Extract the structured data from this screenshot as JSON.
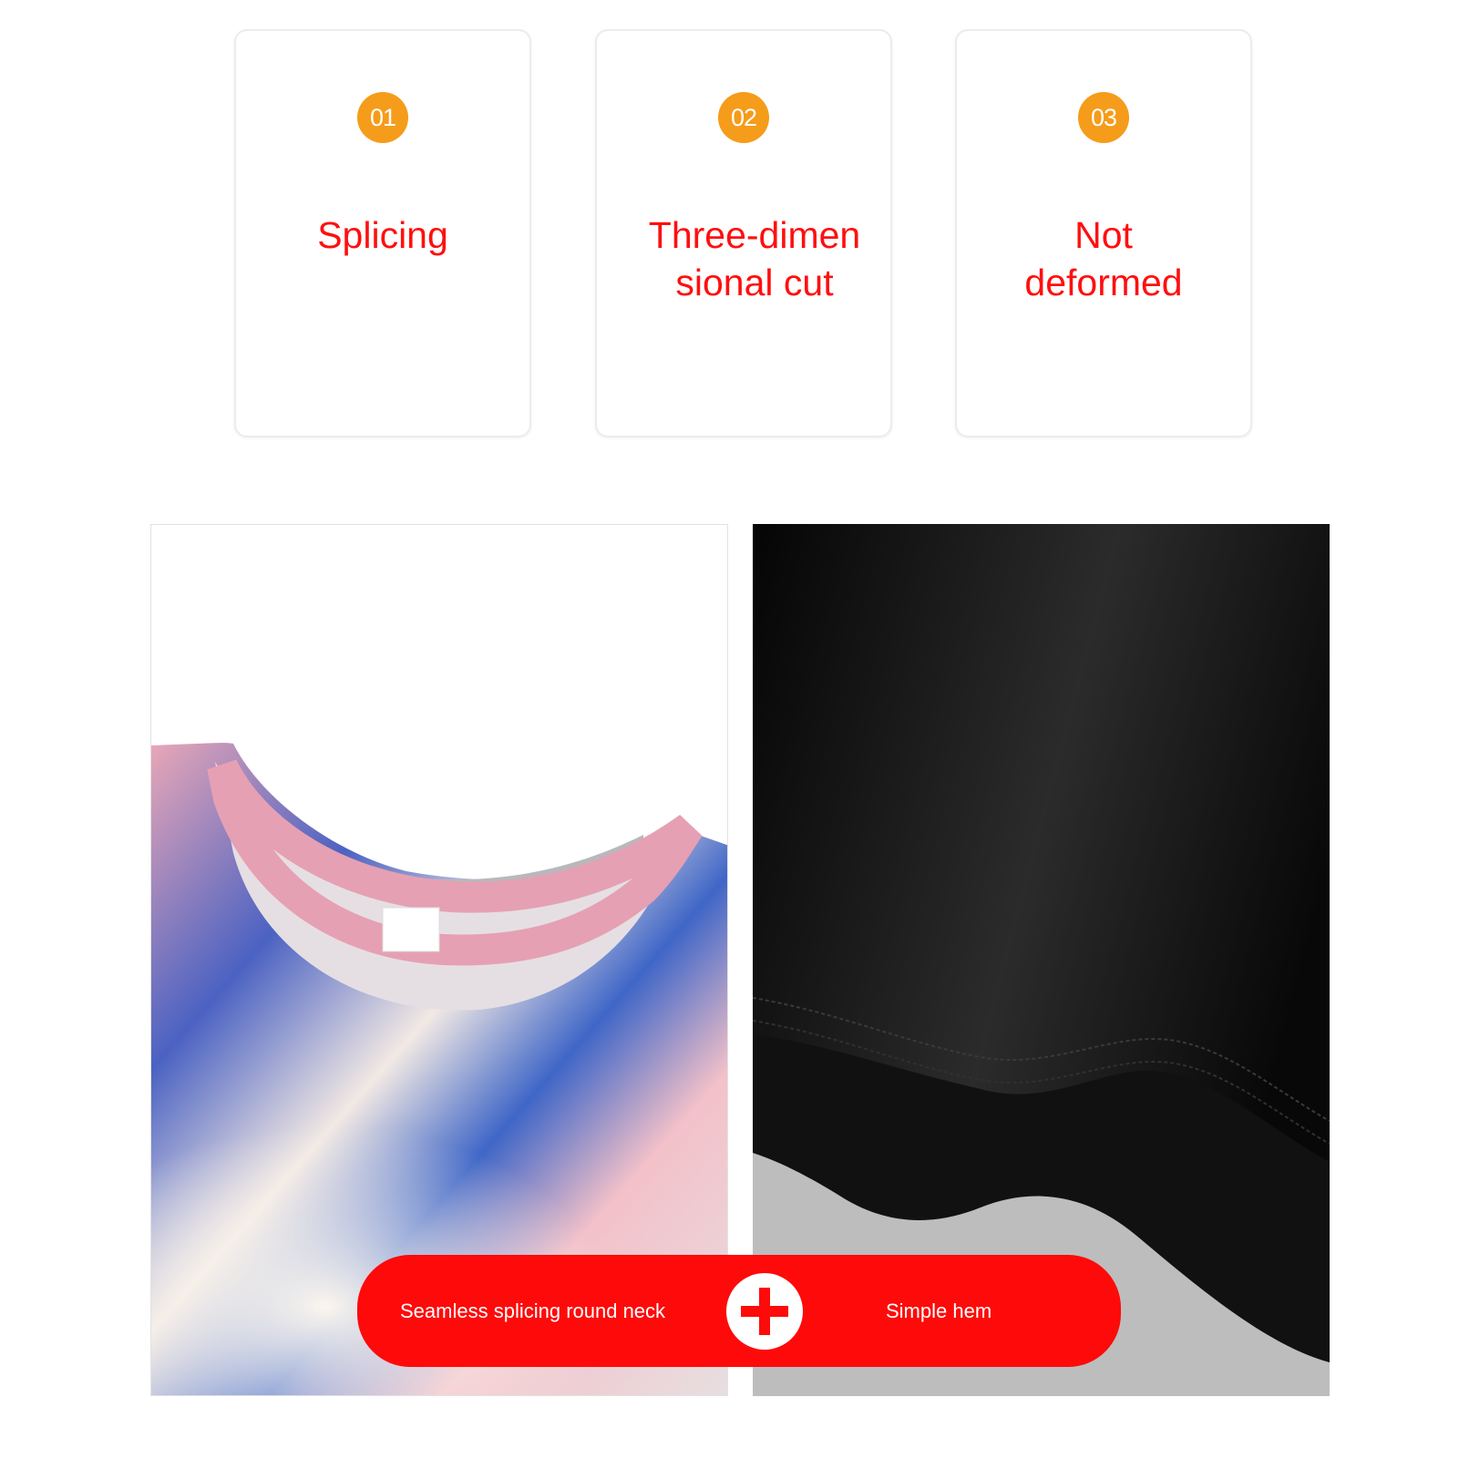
{
  "colors": {
    "badge": "#f59c1a",
    "title_text": "#ff0f0f",
    "pill": "#ff0a0a",
    "pill_text": "#ffffff"
  },
  "features": [
    {
      "number": "01",
      "title": "Splicing"
    },
    {
      "number": "02",
      "title": "Three-dimen sional cut"
    },
    {
      "number": "03",
      "title": "Not deformed"
    }
  ],
  "photos": {
    "left": {
      "subject": "galaxy-print round neck shirt photo"
    },
    "right": {
      "subject": "black shirt hem photo"
    }
  },
  "banner": {
    "left_label": "Seamless splicing round neck",
    "right_label": "Simple hem",
    "plus_icon": "plus-icon"
  }
}
